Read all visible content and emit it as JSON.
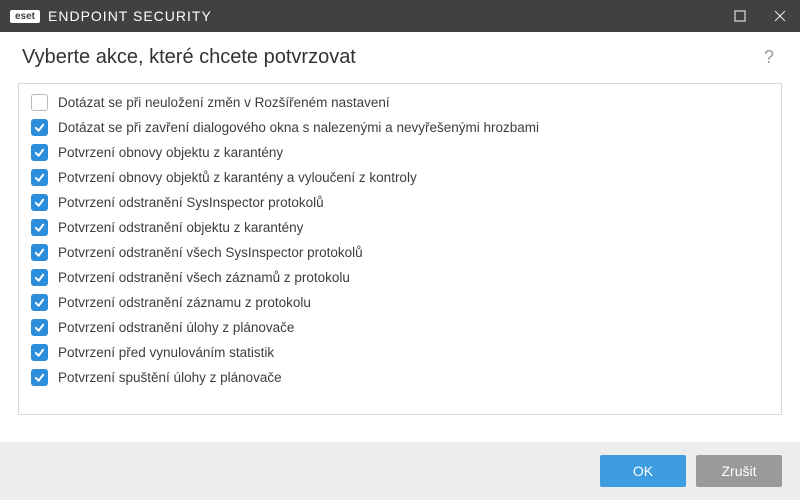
{
  "titlebar": {
    "brand_badge": "eset",
    "brand_name": "ENDPOINT SECURITY"
  },
  "header": {
    "title": "Vyberte akce, které chcete potvrzovat",
    "help_tooltip": "?"
  },
  "options": [
    {
      "label": "Dotázat se při neuložení změn v Rozšířeném nastavení",
      "checked": false
    },
    {
      "label": "Dotázat se při zavření dialogového okna s nalezenými a nevyřešenými hrozbami",
      "checked": true
    },
    {
      "label": "Potvrzení obnovy objektu z karantény",
      "checked": true
    },
    {
      "label": "Potvrzení obnovy objektů z karantény a vyloučení z kontroly",
      "checked": true
    },
    {
      "label": "Potvrzení odstranění SysInspector protokolů",
      "checked": true
    },
    {
      "label": "Potvrzení odstranění objektu z karantény",
      "checked": true
    },
    {
      "label": "Potvrzení odstranění všech SysInspector protokolů",
      "checked": true
    },
    {
      "label": "Potvrzení odstranění všech záznamů z protokolu",
      "checked": true
    },
    {
      "label": "Potvrzení odstranění záznamu z protokolu",
      "checked": true
    },
    {
      "label": "Potvrzení odstranění úlohy z plánovače",
      "checked": true
    },
    {
      "label": "Potvrzení před vynulováním statistik",
      "checked": true
    },
    {
      "label": "Potvrzení spuštění úlohy z plánovače",
      "checked": true
    }
  ],
  "footer": {
    "ok_label": "OK",
    "cancel_label": "Zrušit"
  }
}
